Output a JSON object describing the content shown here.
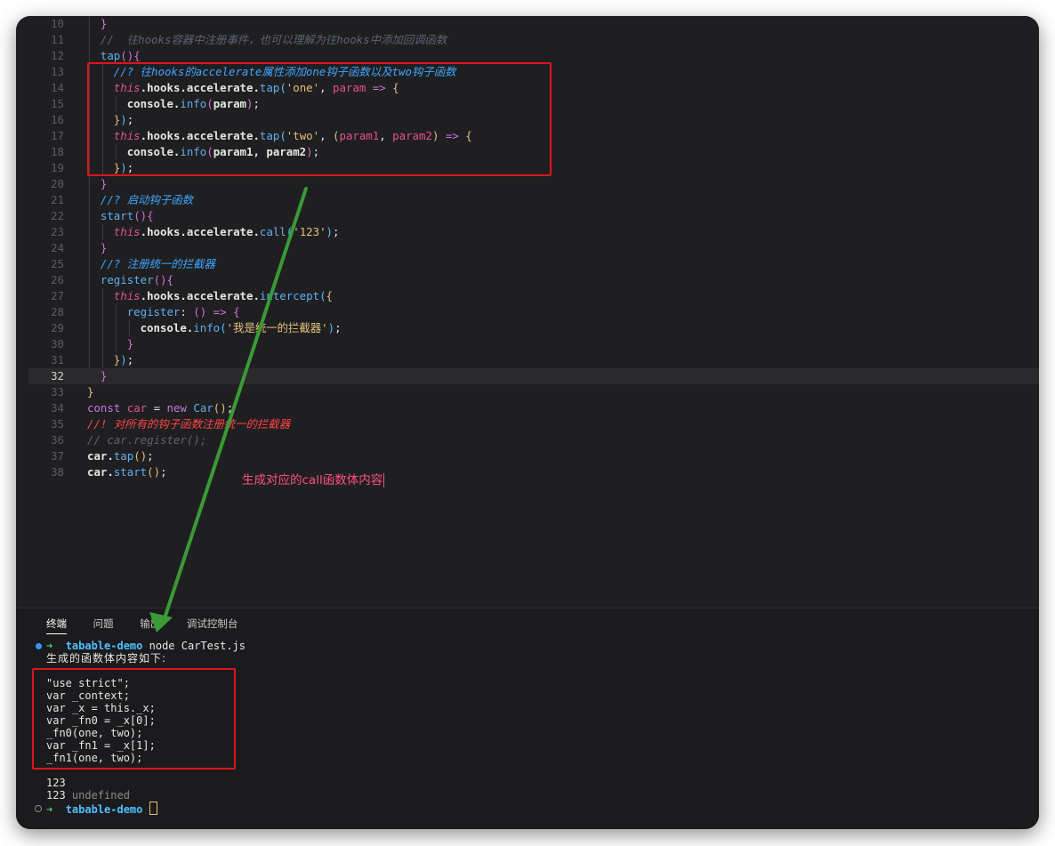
{
  "editor": {
    "current_line": 32,
    "lines": [
      {
        "n": 10,
        "indent": 1,
        "tokens": [
          [
            "}",
            "br2"
          ]
        ]
      },
      {
        "n": 11,
        "indent": 1,
        "tokens": [
          [
            "//  往hooks容器中注册事件，也可以理解为往hooks中添加回调函数",
            "cmt"
          ]
        ]
      },
      {
        "n": 12,
        "indent": 1,
        "tokens": [
          [
            "tap",
            "fn"
          ],
          [
            "()",
            "br2"
          ],
          [
            "{",
            "br2"
          ]
        ]
      },
      {
        "n": 13,
        "indent": 2,
        "tokens": [
          [
            "//? 往hooks的accelerate属性添加one钩子函数以及two钩子函数",
            "cmt-q"
          ]
        ]
      },
      {
        "n": 14,
        "indent": 2,
        "tokens": [
          [
            "this",
            "this"
          ],
          [
            ".hooks.accelerate.",
            "prop"
          ],
          [
            "tap",
            "fn"
          ],
          [
            "(",
            "br3"
          ],
          [
            "'one'",
            "str"
          ],
          [
            ", ",
            "plain"
          ],
          [
            "param",
            "param"
          ],
          [
            " => ",
            "op"
          ],
          [
            "{",
            "br1"
          ]
        ]
      },
      {
        "n": 15,
        "indent": 3,
        "tokens": [
          [
            "console.",
            "prop"
          ],
          [
            "info",
            "fn"
          ],
          [
            "(",
            "br2"
          ],
          [
            "param",
            "prop"
          ],
          [
            ")",
            "br2"
          ],
          [
            ";",
            "plain"
          ]
        ]
      },
      {
        "n": 16,
        "indent": 2,
        "tokens": [
          [
            "}",
            "br1"
          ],
          [
            ")",
            "br3"
          ],
          [
            ";",
            "plain"
          ]
        ]
      },
      {
        "n": 17,
        "indent": 2,
        "tokens": [
          [
            "this",
            "this"
          ],
          [
            ".hooks.accelerate.",
            "prop"
          ],
          [
            "tap",
            "fn"
          ],
          [
            "(",
            "br3"
          ],
          [
            "'two'",
            "str"
          ],
          [
            ", ",
            "plain"
          ],
          [
            "(",
            "br1"
          ],
          [
            "param1",
            "param"
          ],
          [
            ", ",
            "plain"
          ],
          [
            "param2",
            "param"
          ],
          [
            ")",
            "br1"
          ],
          [
            " => ",
            "op"
          ],
          [
            "{",
            "br1"
          ]
        ]
      },
      {
        "n": 18,
        "indent": 3,
        "tokens": [
          [
            "console.",
            "prop"
          ],
          [
            "info",
            "fn"
          ],
          [
            "(",
            "br2"
          ],
          [
            "param1, param2",
            "prop"
          ],
          [
            ")",
            "br2"
          ],
          [
            ";",
            "plain"
          ]
        ]
      },
      {
        "n": 19,
        "indent": 2,
        "tokens": [
          [
            "}",
            "br1"
          ],
          [
            ")",
            "br3"
          ],
          [
            ";",
            "plain"
          ]
        ]
      },
      {
        "n": 20,
        "indent": 1,
        "tokens": [
          [
            "}",
            "br2"
          ]
        ]
      },
      {
        "n": 21,
        "indent": 1,
        "tokens": [
          [
            "//? 启动钩子函数",
            "cmt-q"
          ]
        ]
      },
      {
        "n": 22,
        "indent": 1,
        "tokens": [
          [
            "start",
            "fn"
          ],
          [
            "()",
            "br2"
          ],
          [
            "{",
            "br2"
          ]
        ]
      },
      {
        "n": 23,
        "indent": 2,
        "tokens": [
          [
            "this",
            "this"
          ],
          [
            ".hooks.accelerate.",
            "prop"
          ],
          [
            "call",
            "fn"
          ],
          [
            "(",
            "br3"
          ],
          [
            "'123'",
            "str"
          ],
          [
            ")",
            "br3"
          ],
          [
            ";",
            "plain"
          ]
        ]
      },
      {
        "n": 24,
        "indent": 1,
        "tokens": [
          [
            "}",
            "br2"
          ]
        ]
      },
      {
        "n": 25,
        "indent": 1,
        "tokens": [
          [
            "//? 注册统一的拦截器",
            "cmt-q"
          ]
        ]
      },
      {
        "n": 26,
        "indent": 1,
        "tokens": [
          [
            "register",
            "fn"
          ],
          [
            "()",
            "br2"
          ],
          [
            "{",
            "br2"
          ]
        ]
      },
      {
        "n": 27,
        "indent": 2,
        "tokens": [
          [
            "this",
            "this"
          ],
          [
            ".hooks.accelerate.",
            "prop"
          ],
          [
            "intercept",
            "fn"
          ],
          [
            "(",
            "br3"
          ],
          [
            "{",
            "br1"
          ]
        ]
      },
      {
        "n": 28,
        "indent": 3,
        "tokens": [
          [
            "register",
            "fn"
          ],
          [
            ": ",
            "plain"
          ],
          [
            "()",
            "br2"
          ],
          [
            " => ",
            "op"
          ],
          [
            "{",
            "br2"
          ]
        ]
      },
      {
        "n": 29,
        "indent": 4,
        "tokens": [
          [
            "console.",
            "prop"
          ],
          [
            "info",
            "fn"
          ],
          [
            "(",
            "br3"
          ],
          [
            "'我是统一的拦截器'",
            "str"
          ],
          [
            ")",
            "br3"
          ],
          [
            ";",
            "plain"
          ]
        ]
      },
      {
        "n": 30,
        "indent": 3,
        "tokens": [
          [
            "}",
            "br2"
          ]
        ]
      },
      {
        "n": 31,
        "indent": 2,
        "tokens": [
          [
            "}",
            "br1"
          ],
          [
            ")",
            "br3"
          ],
          [
            ";",
            "plain"
          ]
        ]
      },
      {
        "n": 32,
        "indent": 1,
        "tokens": [
          [
            "}",
            "br2"
          ]
        ]
      },
      {
        "n": 33,
        "indent": 0,
        "tokens": [
          [
            "}",
            "br1"
          ]
        ]
      },
      {
        "n": 34,
        "indent": 0,
        "tokens": [
          [
            "const ",
            "kw"
          ],
          [
            "car",
            "param"
          ],
          [
            " = ",
            "plain"
          ],
          [
            "new ",
            "kw"
          ],
          [
            "Car",
            "fn"
          ],
          [
            "()",
            "br1"
          ],
          [
            ";",
            "plain"
          ]
        ]
      },
      {
        "n": 35,
        "indent": 0,
        "tokens": [
          [
            "//! 对所有的钩子函数注册统一的拦截器",
            "cmt-x"
          ]
        ]
      },
      {
        "n": 36,
        "indent": 0,
        "tokens": [
          [
            "// car.register();",
            "cmt"
          ]
        ]
      },
      {
        "n": 37,
        "indent": 0,
        "tokens": [
          [
            "car.",
            "prop"
          ],
          [
            "tap",
            "fn"
          ],
          [
            "()",
            "br1"
          ],
          [
            ";",
            "plain"
          ]
        ]
      },
      {
        "n": 38,
        "indent": 0,
        "tokens": [
          [
            "car.",
            "prop"
          ],
          [
            "start",
            "fn"
          ],
          [
            "()",
            "br1"
          ],
          [
            ";",
            "plain"
          ]
        ]
      }
    ]
  },
  "annotation": {
    "text": "生成对应的call函数体内容"
  },
  "colors": {
    "highlight_box": "#e0141c",
    "arrow": "#3a9a35",
    "accent_blue": "#3794ff"
  },
  "panel": {
    "tabs": [
      {
        "label": "终端",
        "active": true
      },
      {
        "label": "问题",
        "active": false
      },
      {
        "label": "输出",
        "active": false
      },
      {
        "label": "调试控制台",
        "active": false
      }
    ],
    "terminal": {
      "prompt_arrow": "➜",
      "dir": "tabable-demo",
      "command": "node CarTest.js",
      "header": "生成的函数体内容如下:",
      "generated_code": [
        "\"use strict\";",
        "var _context;",
        "var _x = this._x;",
        "var _fn0 = _x[0];",
        "_fn0(one, two);",
        "var _fn1 = _x[1];",
        "_fn1(one, two);"
      ],
      "output": [
        "123",
        "123"
      ],
      "output_suffix": "undefined"
    }
  }
}
